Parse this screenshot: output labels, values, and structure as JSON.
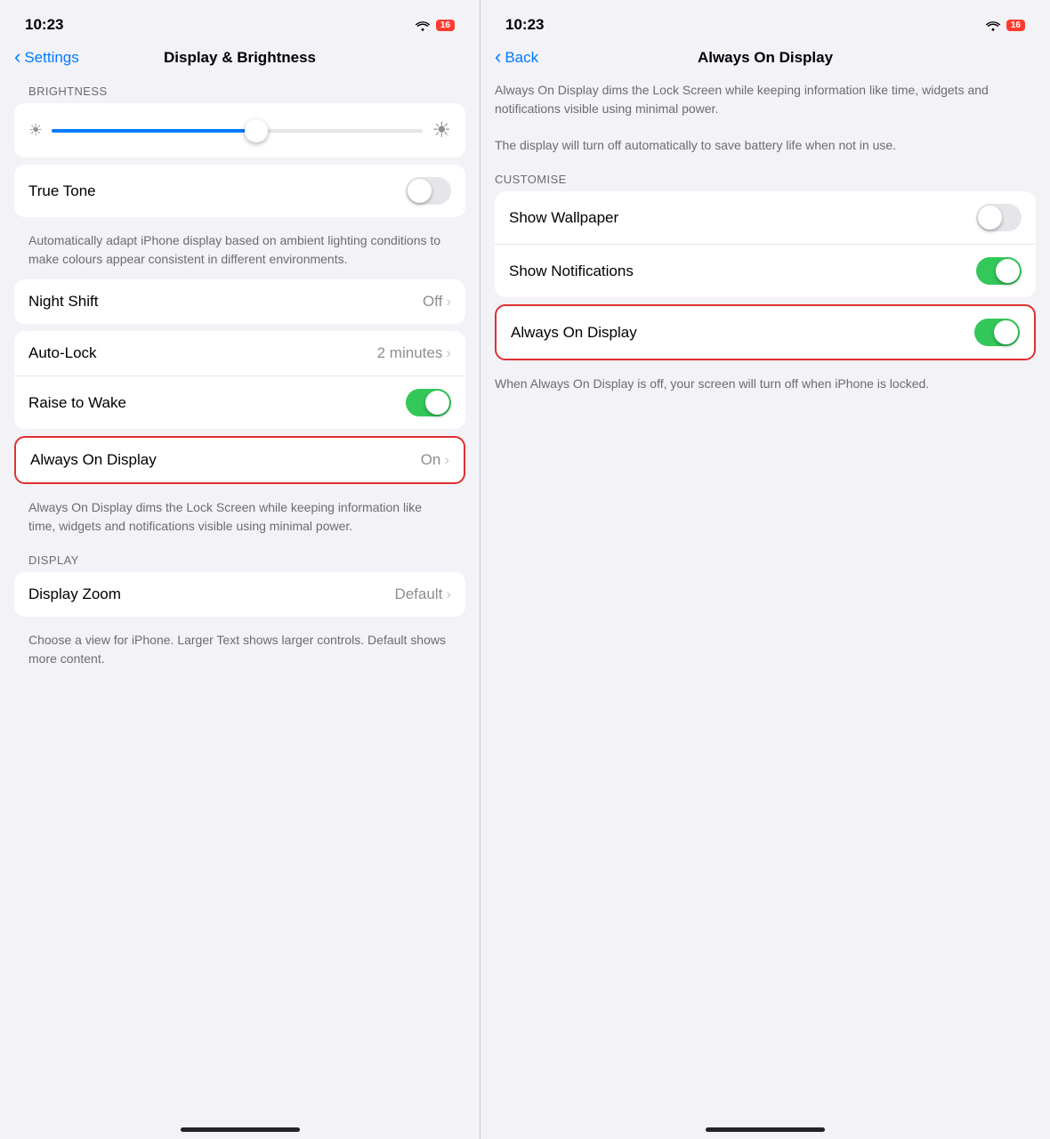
{
  "left": {
    "status": {
      "time": "10:23",
      "battery_number": "16"
    },
    "nav": {
      "back_label": "Settings",
      "title": "Display & Brightness"
    },
    "brightness": {
      "section_label": "BRIGHTNESS"
    },
    "true_tone": {
      "label": "True Tone",
      "toggle_state": "off"
    },
    "true_tone_desc": "Automatically adapt iPhone display based on ambient lighting conditions to make colours appear consistent in different environments.",
    "night_shift": {
      "label": "Night Shift",
      "value": "Off"
    },
    "auto_lock": {
      "label": "Auto-Lock",
      "value": "2 minutes"
    },
    "raise_to_wake": {
      "label": "Raise to Wake",
      "toggle_state": "on"
    },
    "always_on_display": {
      "label": "Always On Display",
      "value": "On"
    },
    "always_on_desc": "Always On Display dims the Lock Screen while keeping information like time, widgets and notifications visible using minimal power.",
    "display_section_label": "DISPLAY",
    "display_zoom": {
      "label": "Display Zoom",
      "value": "Default"
    },
    "display_zoom_desc": "Choose a view for iPhone. Larger Text shows larger controls. Default shows more content."
  },
  "right": {
    "status": {
      "time": "10:23",
      "battery_number": "16"
    },
    "nav": {
      "back_label": "Back",
      "title": "Always On Display"
    },
    "desc1": "Always On Display dims the Lock Screen while keeping information like time, widgets and notifications visible using minimal power.",
    "desc2": "The display will turn off automatically to save battery life when not in use.",
    "customise_label": "CUSTOMISE",
    "show_wallpaper": {
      "label": "Show Wallpaper",
      "toggle_state": "off"
    },
    "show_notifications": {
      "label": "Show Notifications",
      "toggle_state": "on"
    },
    "always_on_display": {
      "label": "Always On Display",
      "toggle_state": "on"
    },
    "always_on_off_desc": "When Always On Display is off, your screen will turn off when iPhone is locked."
  }
}
